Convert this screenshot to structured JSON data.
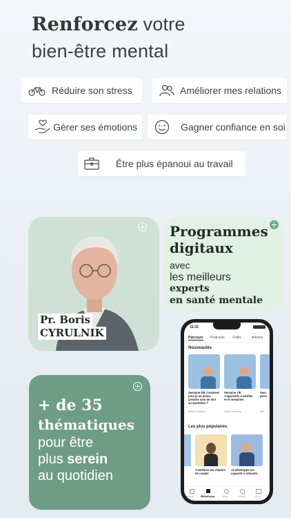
{
  "hero": {
    "line1_bold": "Renforcez",
    "line1_rest": " votre",
    "line2": "bien-être mental"
  },
  "chips": [
    {
      "label": "Réduire son stress",
      "icon": "bicycle-icon"
    },
    {
      "label": "Améliorer mes relations",
      "icon": "people-icon"
    },
    {
      "label": "Gérer ses émotions",
      "icon": "hand-heart-icon"
    },
    {
      "label": "Gagner confiance en soi",
      "icon": "smiley-icon"
    },
    {
      "label": "Être plus épanoui au travail",
      "icon": "briefcase-icon"
    }
  ],
  "expert_card": {
    "name_line1": "Pr. Boris",
    "name_line2": "CYRULNIK",
    "bg": "#cfe0d6"
  },
  "programs_card": {
    "title1": "Programmes",
    "title2": "digitaux",
    "line1": "avec",
    "line2": "les meilleurs",
    "line3": "experts",
    "line4": "en santé mentale",
    "bg": "#e2f1e6"
  },
  "themes_card": {
    "line1": "+ de 35",
    "line2": "thématiques",
    "line3": "pour être",
    "line4_a": "plus ",
    "line4_b": "serein",
    "line5": "au quotidien",
    "bg": "#6f9c87"
  },
  "phone": {
    "time": "16:32",
    "tabs": [
      "Parcours",
      "Podcasts",
      "Outils",
      "Articles"
    ],
    "section1": "Nouveautés",
    "cards": [
      {
        "title": "Semaine 8/8 Comment puis-je au mieux prendre soin de moi au quotidien ?",
        "author": "Adrien Jimenez"
      },
      {
        "title": "Semaine 7/8 J'apprends à méditer en 8 semaines",
        "author": "Adrien Jimenez"
      },
      {
        "title": "Sem pens",
        "author": "Adri"
      }
    ],
    "section2": "Les plus populaires",
    "popular": [
      {
        "title": "J'améliore ma relation de couple"
      },
      {
        "title": "Je développe ma capacité à rebondir"
      }
    ],
    "nav": [
      "Accueil",
      "Bibliothèque",
      "Bilan",
      "Favoris",
      "Profil"
    ]
  }
}
